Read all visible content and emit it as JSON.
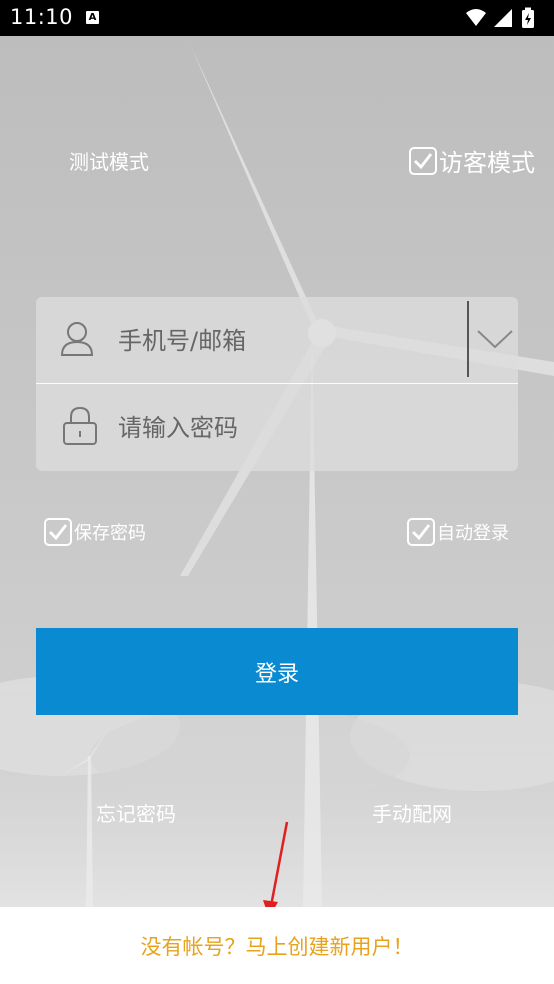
{
  "status_bar": {
    "time": "11:10",
    "notification_badge": "A"
  },
  "top_options": {
    "test_mode_label": "测试模式",
    "visitor_mode_label": "访客模式",
    "visitor_mode_checked": true
  },
  "login_form": {
    "account_placeholder": "手机号/邮箱",
    "password_placeholder": "请输入密码",
    "account_icon": "user-icon",
    "password_icon": "lock-icon",
    "dropdown_icon": "chevron-down-icon"
  },
  "options": {
    "save_password_label": "保存密码",
    "save_password_checked": true,
    "auto_login_label": "自动登录",
    "auto_login_checked": true
  },
  "login_button_label": "登录",
  "links": {
    "forgot_password": "忘记密码",
    "manual_network": "手动配网"
  },
  "footer": {
    "signup_text": "没有帐号？马上创建新用户！"
  },
  "colors": {
    "primary": "#0a8bd1",
    "signup": "#e8a21c",
    "annotation_arrow": "#e02020"
  }
}
